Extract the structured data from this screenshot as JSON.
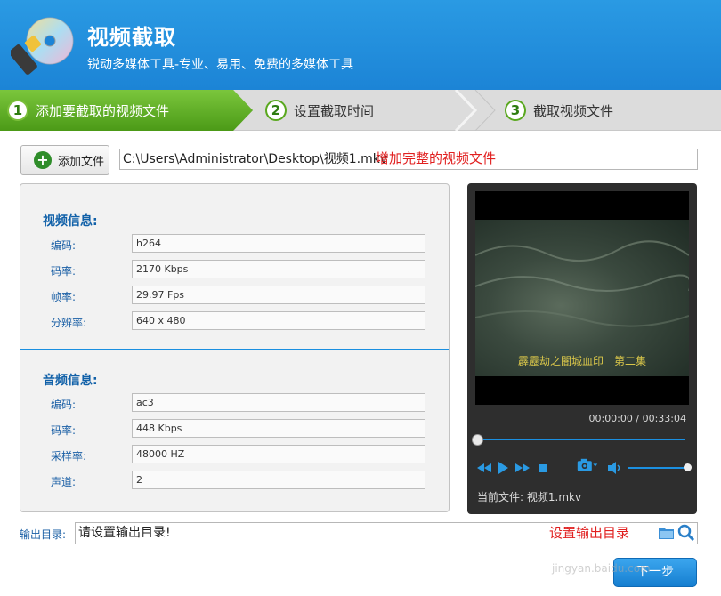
{
  "header": {
    "title": "视频截取",
    "subtitle": "锐动多媒体工具-专业、易用、免费的多媒体工具"
  },
  "steps": [
    {
      "num": "1",
      "label": "添加要截取的视频文件"
    },
    {
      "num": "2",
      "label": "设置截取时间"
    },
    {
      "num": "3",
      "label": "截取视频文件"
    }
  ],
  "add_file": {
    "button_label": "添加文件",
    "path_value": "C:\\Users\\Administrator\\Desktop\\视频1.mkv",
    "hint": "增加完整的视频文件"
  },
  "video_info": {
    "title": "视频信息:",
    "fields": [
      {
        "label": "编码:",
        "value": "h264"
      },
      {
        "label": "码率:",
        "value": "2170 Kbps"
      },
      {
        "label": "帧率:",
        "value": "29.97 Fps"
      },
      {
        "label": "分辨率:",
        "value": "640 x 480"
      }
    ]
  },
  "audio_info": {
    "title": "音频信息:",
    "fields": [
      {
        "label": "编码:",
        "value": "ac3"
      },
      {
        "label": "码率:",
        "value": "448 Kbps"
      },
      {
        "label": "采样率:",
        "value": "48000 HZ"
      },
      {
        "label": "声道:",
        "value": "2"
      }
    ]
  },
  "player": {
    "subtitle": "霹靂劫之闇城血印　第二集",
    "time": "00:00:00 / 00:33:04",
    "progress": 0,
    "volume": 1,
    "current_file_label": "当前文件:",
    "current_file_name": "视频1.mkv",
    "icons": [
      "rewind-icon",
      "play-icon",
      "fast-forward-icon",
      "stop-icon",
      "camera-icon",
      "volume-icon"
    ]
  },
  "output": {
    "label": "输出目录:",
    "placeholder": "请设置输出目录!",
    "hint": "设置输出目录",
    "icons": [
      "folder-icon",
      "search-icon"
    ]
  },
  "next_button_label": "下一步",
  "watermark": "jingyan.baidu.com",
  "colors": {
    "accent": "#1c84d6",
    "step_active": "#5aaa1e",
    "hint_red": "#e12020",
    "label_blue": "#1a5fa5"
  }
}
